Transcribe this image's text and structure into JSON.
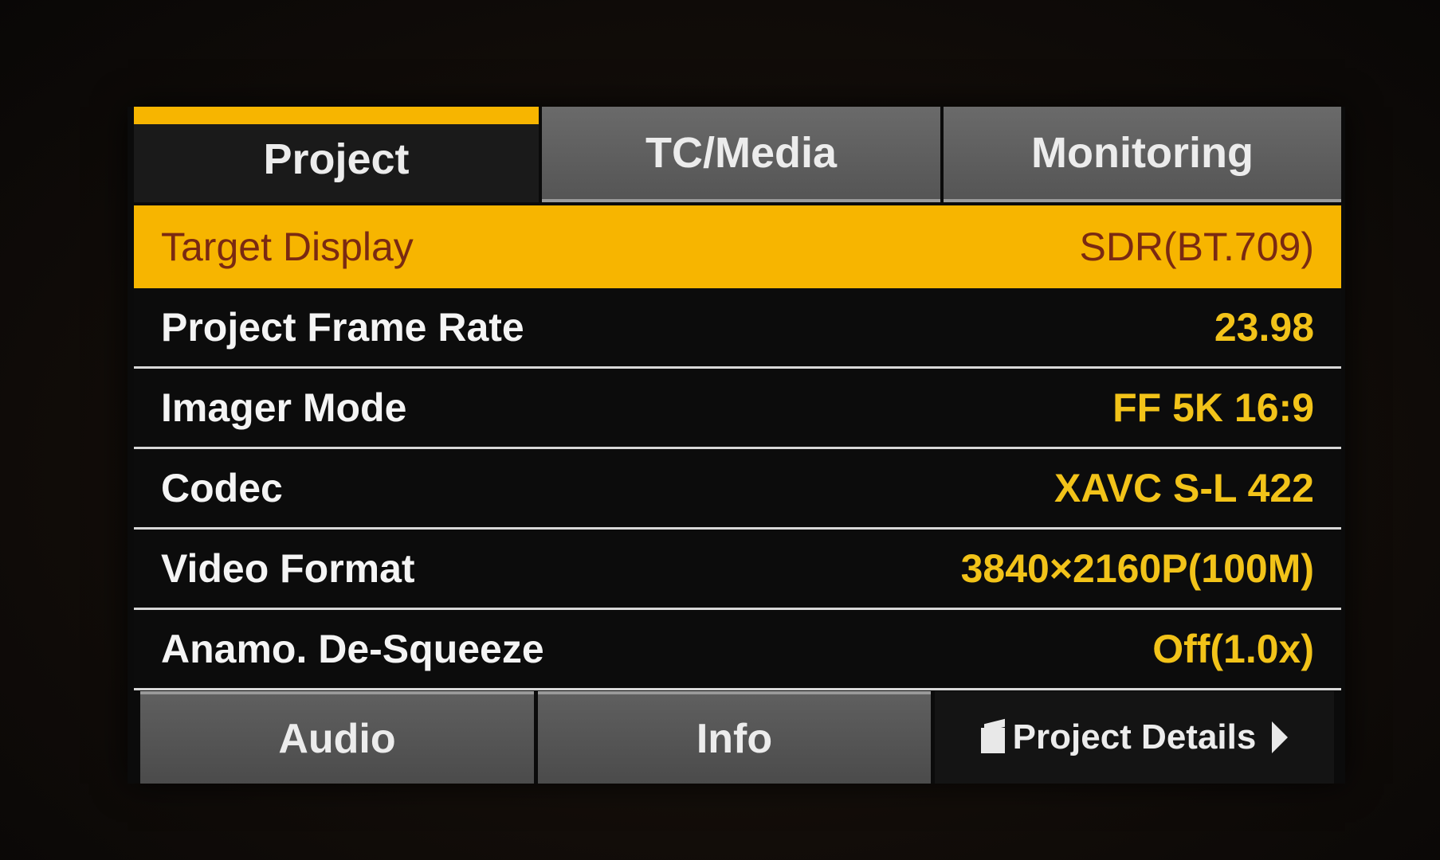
{
  "tabs": {
    "project": "Project",
    "tc_media": "TC/Media",
    "monitoring": "Monitoring"
  },
  "rows": [
    {
      "label": "Target Display",
      "value": "SDR(BT.709)"
    },
    {
      "label": "Project Frame Rate",
      "value": "23.98"
    },
    {
      "label": "Imager Mode",
      "value": "FF 5K 16:9"
    },
    {
      "label": "Codec",
      "value": "XAVC S-L 422"
    },
    {
      "label": "Video Format",
      "value": "3840×2160P(100M)"
    },
    {
      "label": "Anamo. De-Squeeze",
      "value": "Off(1.0x)"
    }
  ],
  "bottom_tabs": {
    "audio": "Audio",
    "info": "Info",
    "project_details": "Project Details"
  },
  "colors": {
    "accent": "#f7b500",
    "value_text": "#f2c319",
    "selected_text": "#7a2a12"
  },
  "icons": {
    "project_details_leading": "folder-icon",
    "project_details_trailing": "chevron-right-icon"
  }
}
